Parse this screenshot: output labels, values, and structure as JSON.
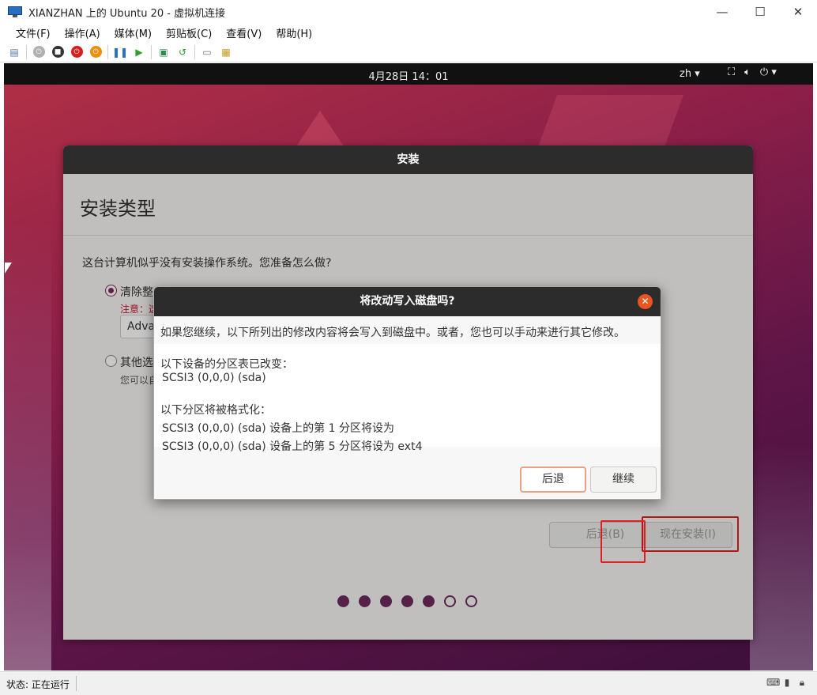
{
  "window": {
    "title": "XIANZHAN 上的 Ubuntu 20 - 虚拟机连接",
    "minimize": "—",
    "maximize": "☐",
    "close": "✕"
  },
  "menu": [
    "文件(F)",
    "操作(A)",
    "媒体(M)",
    "剪贴板(C)",
    "查看(V)",
    "帮助(H)"
  ],
  "vm_topbar": {
    "datetime": "4月28日  14：01",
    "input_method": "zh ▾",
    "network_icon": "network-icon",
    "volume_icon": "volume-icon",
    "power_icon": "power-icon"
  },
  "installer": {
    "header": "安装",
    "page_title": "安装类型",
    "question": "这台计算机似乎没有安装操作系统。您准备怎么做?",
    "option1": "清除整",
    "option1_note": "注意：这",
    "advanced_button": "Adva",
    "option2": "其他选",
    "option2_sub": "您可以自",
    "back_button": "后退(B)",
    "install_button": "现在安装(I)",
    "progress_total": 7,
    "progress_done": 5
  },
  "dialog": {
    "title": "将改动写入磁盘吗?",
    "message": "如果您继续，以下所列出的修改内容将会写入到磁盘中。或者，您也可以手动来进行其它修改。",
    "partition_table_heading": "以下设备的分区表已改变：",
    "partition_table_device": "SCSI3 (0,0,0) (sda)",
    "format_heading": "以下分区将被格式化：",
    "format_item1": "SCSI3 (0,0,0) (sda) 设备上的第 1 分区将设为",
    "format_item2": "SCSI3 (0,0,0) (sda) 设备上的第 5 分区将设为 ext4",
    "back_button": "后退",
    "continue_button": "继续"
  },
  "statusbar": {
    "status": "状态: 正在运行"
  },
  "colors": {
    "accent": "#e95420",
    "progress": "#6e2b5d",
    "highlight": "#e02020"
  }
}
